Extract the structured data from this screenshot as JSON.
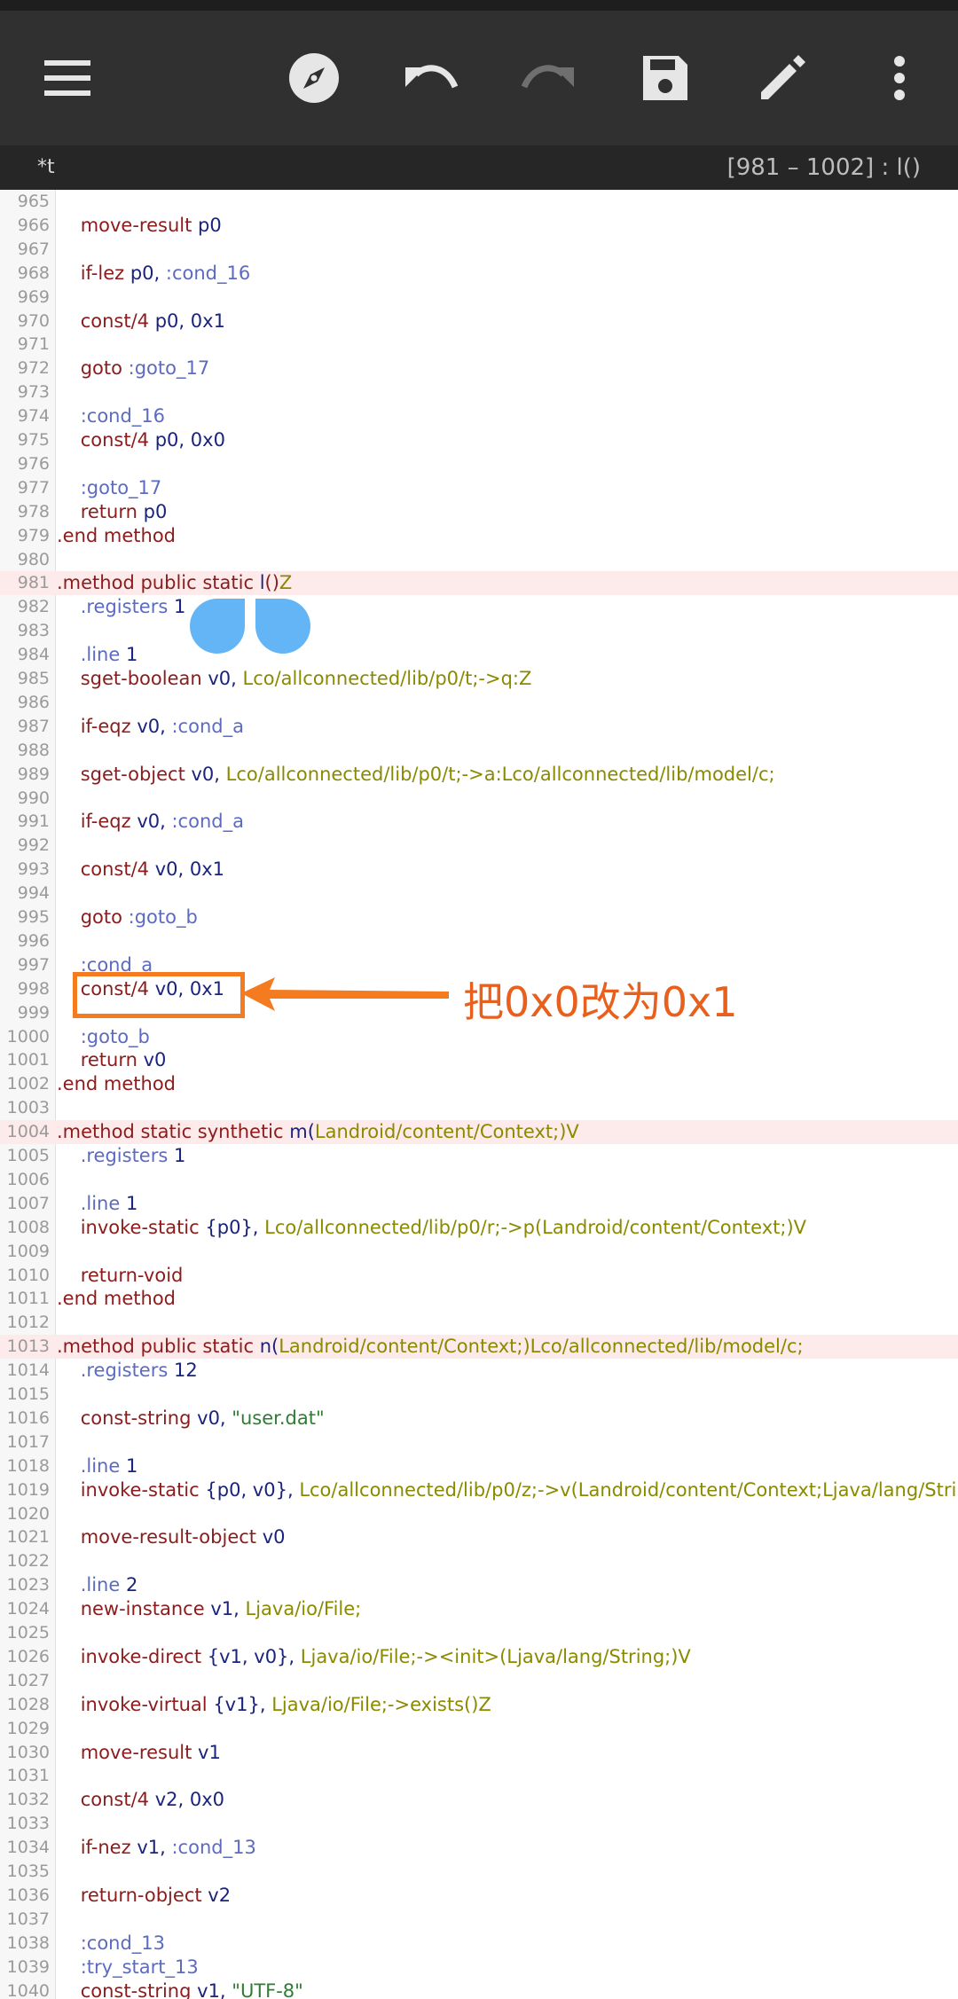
{
  "toolbar": {
    "icons": [
      "menu-icon",
      "compass-icon",
      "undo-icon",
      "redo-icon",
      "save-icon",
      "edit-icon",
      "more-vert-icon"
    ],
    "bg": "#303030"
  },
  "subbar": {
    "tab": "*t",
    "range": "[981 – 1002] : l()"
  },
  "annotation": {
    "text": "把0x0改为0x1",
    "color": "#f47b20"
  },
  "lines": [
    {
      "n": "965",
      "t": []
    },
    {
      "n": "966",
      "t": [
        [
          "    ",
          ""
        ],
        [
          "move-result",
          "kw"
        ],
        [
          " ",
          ""
        ],
        [
          "p0",
          "reg"
        ]
      ]
    },
    {
      "n": "967",
      "t": []
    },
    {
      "n": "968",
      "t": [
        [
          "    ",
          ""
        ],
        [
          "if-lez",
          "kw"
        ],
        [
          " ",
          ""
        ],
        [
          "p0,",
          "reg"
        ],
        [
          " ",
          ""
        ],
        [
          ":cond_16",
          "lbl"
        ]
      ]
    },
    {
      "n": "969",
      "t": []
    },
    {
      "n": "970",
      "t": [
        [
          "    ",
          ""
        ],
        [
          "const/4",
          "kw"
        ],
        [
          " ",
          ""
        ],
        [
          "p0,",
          "reg"
        ],
        [
          " ",
          ""
        ],
        [
          "0x1",
          "hex"
        ]
      ]
    },
    {
      "n": "971",
      "t": []
    },
    {
      "n": "972",
      "t": [
        [
          "    ",
          ""
        ],
        [
          "goto",
          "kw"
        ],
        [
          " ",
          ""
        ],
        [
          ":goto_17",
          "lbl"
        ]
      ]
    },
    {
      "n": "973",
      "t": []
    },
    {
      "n": "974",
      "t": [
        [
          "    ",
          ""
        ],
        [
          ":cond_16",
          "lbl"
        ]
      ]
    },
    {
      "n": "975",
      "t": [
        [
          "    ",
          ""
        ],
        [
          "const/4",
          "kw"
        ],
        [
          " ",
          ""
        ],
        [
          "p0,",
          "reg"
        ],
        [
          " ",
          ""
        ],
        [
          "0x0",
          "hex"
        ]
      ]
    },
    {
      "n": "976",
      "t": []
    },
    {
      "n": "977",
      "t": [
        [
          "    ",
          ""
        ],
        [
          ":goto_17",
          "lbl"
        ]
      ]
    },
    {
      "n": "978",
      "t": [
        [
          "    ",
          ""
        ],
        [
          "return",
          "kw"
        ],
        [
          " ",
          ""
        ],
        [
          "p0",
          "reg"
        ]
      ]
    },
    {
      "n": "979",
      "t": [
        [
          ".end method",
          "kw"
        ]
      ]
    },
    {
      "n": "980",
      "t": []
    },
    {
      "n": "981",
      "hl": true,
      "t": [
        [
          ".method",
          "kw"
        ],
        [
          " ",
          ""
        ],
        [
          "public static",
          "kw"
        ],
        [
          " ",
          ""
        ],
        [
          "l",
          "reg"
        ],
        [
          "()",
          "kw"
        ],
        [
          "Z",
          "typ"
        ]
      ]
    },
    {
      "n": "982",
      "t": [
        [
          "    ",
          ""
        ],
        [
          ".registers",
          "lbl"
        ],
        [
          " ",
          ""
        ],
        [
          "1",
          "reg"
        ]
      ]
    },
    {
      "n": "983",
      "t": []
    },
    {
      "n": "984",
      "t": [
        [
          "    ",
          ""
        ],
        [
          ".line",
          "lbl"
        ],
        [
          " ",
          ""
        ],
        [
          "1",
          "reg"
        ]
      ]
    },
    {
      "n": "985",
      "t": [
        [
          "    ",
          ""
        ],
        [
          "sget-boolean",
          "kw"
        ],
        [
          " ",
          ""
        ],
        [
          "v0,",
          "reg"
        ],
        [
          " ",
          ""
        ],
        [
          "Lco/allconnected/lib/p0/t;->q:Z",
          "typ"
        ]
      ]
    },
    {
      "n": "986",
      "t": []
    },
    {
      "n": "987",
      "t": [
        [
          "    ",
          ""
        ],
        [
          "if-eqz",
          "kw"
        ],
        [
          " ",
          ""
        ],
        [
          "v0,",
          "reg"
        ],
        [
          " ",
          ""
        ],
        [
          ":cond_a",
          "lbl"
        ]
      ]
    },
    {
      "n": "988",
      "t": []
    },
    {
      "n": "989",
      "t": [
        [
          "    ",
          ""
        ],
        [
          "sget-object",
          "kw"
        ],
        [
          " ",
          ""
        ],
        [
          "v0,",
          "reg"
        ],
        [
          " ",
          ""
        ],
        [
          "Lco/allconnected/lib/p0/t;->a:Lco/allconnected/lib/model/c;",
          "typ"
        ]
      ]
    },
    {
      "n": "990",
      "t": []
    },
    {
      "n": "991",
      "t": [
        [
          "    ",
          ""
        ],
        [
          "if-eqz",
          "kw"
        ],
        [
          " ",
          ""
        ],
        [
          "v0,",
          "reg"
        ],
        [
          " ",
          ""
        ],
        [
          ":cond_a",
          "lbl"
        ]
      ]
    },
    {
      "n": "992",
      "t": []
    },
    {
      "n": "993",
      "t": [
        [
          "    ",
          ""
        ],
        [
          "const/4",
          "kw"
        ],
        [
          " ",
          ""
        ],
        [
          "v0,",
          "reg"
        ],
        [
          " ",
          ""
        ],
        [
          "0x1",
          "hex"
        ]
      ]
    },
    {
      "n": "994",
      "t": []
    },
    {
      "n": "995",
      "t": [
        [
          "    ",
          ""
        ],
        [
          "goto",
          "kw"
        ],
        [
          " ",
          ""
        ],
        [
          ":goto_b",
          "lbl"
        ]
      ]
    },
    {
      "n": "996",
      "t": []
    },
    {
      "n": "997",
      "t": [
        [
          "    ",
          ""
        ],
        [
          ":cond_a",
          "lbl"
        ]
      ]
    },
    {
      "n": "998",
      "t": [
        [
          "    ",
          ""
        ],
        [
          "const/4",
          "kw"
        ],
        [
          " ",
          ""
        ],
        [
          "v0,",
          "reg"
        ],
        [
          " ",
          ""
        ],
        [
          "0x1",
          "hex"
        ]
      ]
    },
    {
      "n": "999",
      "t": []
    },
    {
      "n": "1000",
      "t": [
        [
          "    ",
          ""
        ],
        [
          ":goto_b",
          "lbl"
        ]
      ]
    },
    {
      "n": "1001",
      "t": [
        [
          "    ",
          ""
        ],
        [
          "return",
          "kw"
        ],
        [
          " ",
          ""
        ],
        [
          "v0",
          "reg"
        ]
      ]
    },
    {
      "n": "1002",
      "t": [
        [
          ".end method",
          "kw"
        ]
      ]
    },
    {
      "n": "1003",
      "t": []
    },
    {
      "n": "1004",
      "hl": true,
      "t": [
        [
          ".method",
          "kw"
        ],
        [
          " ",
          ""
        ],
        [
          "static synthetic",
          "kw"
        ],
        [
          " ",
          ""
        ],
        [
          "m(",
          "reg"
        ],
        [
          "Landroid/content/Context;",
          "typ"
        ],
        [
          ")V",
          "typ"
        ]
      ]
    },
    {
      "n": "1005",
      "t": [
        [
          "    ",
          ""
        ],
        [
          ".registers",
          "lbl"
        ],
        [
          " ",
          ""
        ],
        [
          "1",
          "reg"
        ]
      ]
    },
    {
      "n": "1006",
      "t": []
    },
    {
      "n": "1007",
      "t": [
        [
          "    ",
          ""
        ],
        [
          ".line",
          "lbl"
        ],
        [
          " ",
          ""
        ],
        [
          "1",
          "reg"
        ]
      ]
    },
    {
      "n": "1008",
      "t": [
        [
          "    ",
          ""
        ],
        [
          "invoke-static",
          "kw"
        ],
        [
          " ",
          ""
        ],
        [
          "{p0},",
          "reg"
        ],
        [
          " ",
          ""
        ],
        [
          "Lco/allconnected/lib/p0/r;->p(Landroid/content/Context;)V",
          "typ"
        ]
      ]
    },
    {
      "n": "1009",
      "t": []
    },
    {
      "n": "1010",
      "t": [
        [
          "    ",
          ""
        ],
        [
          "return-void",
          "kw"
        ]
      ]
    },
    {
      "n": "1011",
      "t": [
        [
          ".end method",
          "kw"
        ]
      ]
    },
    {
      "n": "1012",
      "t": []
    },
    {
      "n": "1013",
      "hl": true,
      "t": [
        [
          ".method",
          "kw"
        ],
        [
          " ",
          ""
        ],
        [
          "public static",
          "kw"
        ],
        [
          " ",
          ""
        ],
        [
          "n(",
          "reg"
        ],
        [
          "Landroid/content/Context;)Lco/allconnected/lib/model/c;",
          "typ"
        ]
      ]
    },
    {
      "n": "1014",
      "t": [
        [
          "    ",
          ""
        ],
        [
          ".registers",
          "lbl"
        ],
        [
          " ",
          ""
        ],
        [
          "12",
          "reg"
        ]
      ]
    },
    {
      "n": "1015",
      "t": []
    },
    {
      "n": "1016",
      "t": [
        [
          "    ",
          ""
        ],
        [
          "const-string",
          "kw"
        ],
        [
          " ",
          ""
        ],
        [
          "v0,",
          "reg"
        ],
        [
          " ",
          ""
        ],
        [
          "\"user.dat\"",
          "str"
        ]
      ]
    },
    {
      "n": "1017",
      "t": []
    },
    {
      "n": "1018",
      "t": [
        [
          "    ",
          ""
        ],
        [
          ".line",
          "lbl"
        ],
        [
          " ",
          ""
        ],
        [
          "1",
          "reg"
        ]
      ]
    },
    {
      "n": "1019",
      "t": [
        [
          "    ",
          ""
        ],
        [
          "invoke-static",
          "kw"
        ],
        [
          " ",
          ""
        ],
        [
          "{p0, v0},",
          "reg"
        ],
        [
          " ",
          ""
        ],
        [
          "Lco/allconnected/lib/p0/z;->v(Landroid/content/Context;Ljava/lang/String;)Lja",
          "typ"
        ]
      ]
    },
    {
      "n": "1020",
      "t": []
    },
    {
      "n": "1021",
      "t": [
        [
          "    ",
          ""
        ],
        [
          "move-result-object",
          "kw"
        ],
        [
          " ",
          ""
        ],
        [
          "v0",
          "reg"
        ]
      ]
    },
    {
      "n": "1022",
      "t": []
    },
    {
      "n": "1023",
      "t": [
        [
          "    ",
          ""
        ],
        [
          ".line",
          "lbl"
        ],
        [
          " ",
          ""
        ],
        [
          "2",
          "reg"
        ]
      ]
    },
    {
      "n": "1024",
      "t": [
        [
          "    ",
          ""
        ],
        [
          "new-instance",
          "kw"
        ],
        [
          " ",
          ""
        ],
        [
          "v1,",
          "reg"
        ],
        [
          " ",
          ""
        ],
        [
          "Ljava/io/File;",
          "typ"
        ]
      ]
    },
    {
      "n": "1025",
      "t": []
    },
    {
      "n": "1026",
      "t": [
        [
          "    ",
          ""
        ],
        [
          "invoke-direct",
          "kw"
        ],
        [
          " ",
          ""
        ],
        [
          "{v1, v0},",
          "reg"
        ],
        [
          " ",
          ""
        ],
        [
          "Ljava/io/File;-><init>(Ljava/lang/String;)V",
          "typ"
        ]
      ]
    },
    {
      "n": "1027",
      "t": []
    },
    {
      "n": "1028",
      "t": [
        [
          "    ",
          ""
        ],
        [
          "invoke-virtual",
          "kw"
        ],
        [
          " ",
          ""
        ],
        [
          "{v1},",
          "reg"
        ],
        [
          " ",
          ""
        ],
        [
          "Ljava/io/File;->exists()Z",
          "typ"
        ]
      ]
    },
    {
      "n": "1029",
      "t": []
    },
    {
      "n": "1030",
      "t": [
        [
          "    ",
          ""
        ],
        [
          "move-result",
          "kw"
        ],
        [
          " ",
          ""
        ],
        [
          "v1",
          "reg"
        ]
      ]
    },
    {
      "n": "1031",
      "t": []
    },
    {
      "n": "1032",
      "t": [
        [
          "    ",
          ""
        ],
        [
          "const/4",
          "kw"
        ],
        [
          " ",
          ""
        ],
        [
          "v2,",
          "reg"
        ],
        [
          " ",
          ""
        ],
        [
          "0x0",
          "hex"
        ]
      ]
    },
    {
      "n": "1033",
      "t": []
    },
    {
      "n": "1034",
      "t": [
        [
          "    ",
          ""
        ],
        [
          "if-nez",
          "kw"
        ],
        [
          " ",
          ""
        ],
        [
          "v1,",
          "reg"
        ],
        [
          " ",
          ""
        ],
        [
          ":cond_13",
          "lbl"
        ]
      ]
    },
    {
      "n": "1035",
      "t": []
    },
    {
      "n": "1036",
      "t": [
        [
          "    ",
          ""
        ],
        [
          "return-object",
          "kw"
        ],
        [
          " ",
          ""
        ],
        [
          "v2",
          "reg"
        ]
      ]
    },
    {
      "n": "1037",
      "t": []
    },
    {
      "n": "1038",
      "t": [
        [
          "    ",
          ""
        ],
        [
          ":cond_13",
          "lbl"
        ]
      ]
    },
    {
      "n": "1039",
      "t": [
        [
          "    ",
          ""
        ],
        [
          ":try_start_13",
          "lbl"
        ]
      ]
    },
    {
      "n": "1040",
      "t": [
        [
          "    ",
          ""
        ],
        [
          "const-string",
          "kw"
        ],
        [
          " ",
          ""
        ],
        [
          "v1,",
          "reg"
        ],
        [
          " ",
          ""
        ],
        [
          "\"UTF-8\"",
          "str"
        ]
      ]
    }
  ]
}
